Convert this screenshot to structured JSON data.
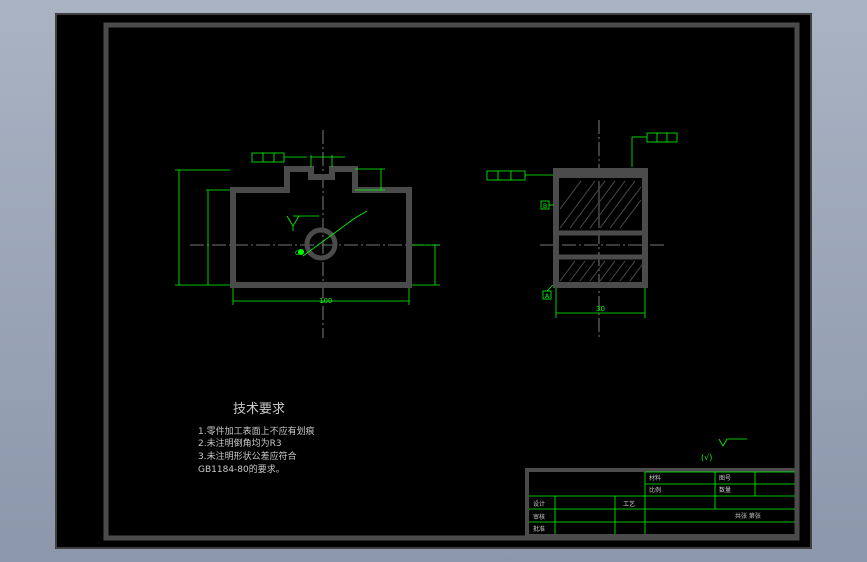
{
  "drawing": {
    "tech_title": "技术要求",
    "tech_notes": [
      "1.零件加工表面上不应有划痕",
      "2.未注明倒角均为R3",
      "3.未注明形状公差应符合",
      "GB1184-80的要求。"
    ],
    "roughness_note": "(√)",
    "datum_labels": {
      "c": "C",
      "b": "B",
      "a": "A"
    },
    "dims": {
      "width_front": "100",
      "side_width": "30"
    }
  },
  "title_block": {
    "material_label": "材料",
    "ratio_label": "比例",
    "scale_label": "数量",
    "drawn_label": "图号",
    "design_label": "设计",
    "check_label": "审核",
    "approve_label": "批准",
    "process_label": "工艺",
    "row_label": "共张 第张"
  },
  "colors": {
    "geometry": "#4b4b4b",
    "annotation": "#00ff00",
    "frame": "#4b4b4b",
    "centerline": "#aaaaaa"
  }
}
